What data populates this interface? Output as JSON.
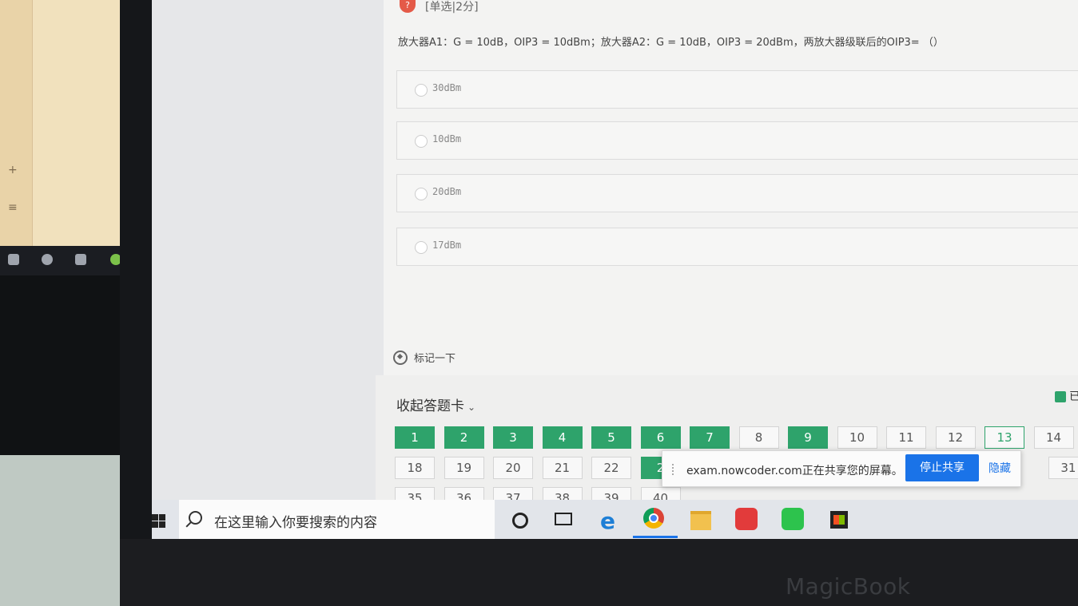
{
  "question": {
    "type_label": "[单选|2分]",
    "text": "放大器A1：G = 10dB，OIP3 = 10dBm；放大器A2：G = 10dB，OIP3 = 20dBm，两放大器级联后的OIP3= （）",
    "options": [
      "30dBm",
      "10dBm",
      "20dBm",
      "17dBm"
    ],
    "mark_label": "标记一下"
  },
  "answer_card": {
    "collapse_label": "收起答题卡",
    "legend_label": "已",
    "numbers": [
      "1",
      "2",
      "3",
      "4",
      "5",
      "6",
      "7",
      "8",
      "9",
      "10",
      "11",
      "12",
      "13",
      "14",
      "18",
      "19",
      "20",
      "21",
      "22",
      "2",
      "31",
      "35",
      "36",
      "37",
      "38",
      "39",
      "40"
    ],
    "answered": [
      "1",
      "2",
      "3",
      "4",
      "5",
      "6",
      "7",
      "9"
    ],
    "current": "13"
  },
  "share_bar": {
    "message": "exam.nowcoder.com正在共享您的屏幕。",
    "stop_label": "停止共享",
    "hide_label": "隐藏"
  },
  "taskbar": {
    "search_placeholder": "在这里输入你要搜索的内容",
    "icons": [
      "windows-start-icon",
      "search-icon",
      "cortana-icon",
      "task-view-icon",
      "edge-icon",
      "chrome-icon",
      "file-explorer-icon",
      "netease-music-icon",
      "wechat-icon",
      "store-icon"
    ]
  },
  "device": {
    "brand": "MagicBook"
  },
  "colors": {
    "answered_green": "#2ea36b",
    "share_blue": "#1a73e8",
    "question_icon_red": "#e45a48"
  }
}
